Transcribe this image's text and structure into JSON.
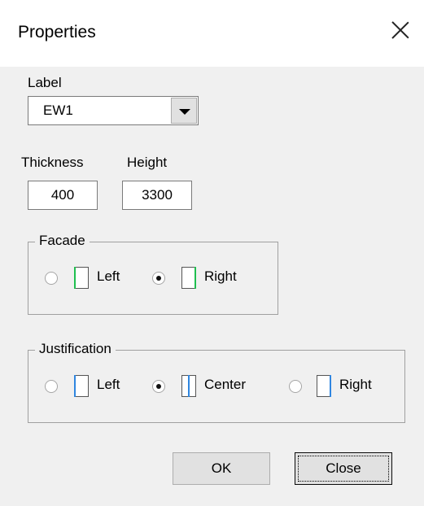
{
  "dialog": {
    "title": "Properties"
  },
  "label_field": {
    "caption": "Label",
    "value": "EW1"
  },
  "thickness_field": {
    "caption": "Thickness",
    "value": "400"
  },
  "height_field": {
    "caption": "Height",
    "value": "3300"
  },
  "facade": {
    "title": "Facade",
    "options": [
      {
        "label": "Left",
        "checked": false,
        "icon": "wall-left-face-icon"
      },
      {
        "label": "Right",
        "checked": true,
        "icon": "wall-right-face-icon"
      }
    ]
  },
  "justification": {
    "title": "Justification",
    "options": [
      {
        "label": "Left",
        "checked": false,
        "icon": "wall-left-justify-icon"
      },
      {
        "label": "Center",
        "checked": true,
        "icon": "wall-center-justify-icon"
      },
      {
        "label": "Right",
        "checked": false,
        "icon": "wall-right-justify-icon"
      }
    ]
  },
  "buttons": {
    "ok": "OK",
    "close": "Close"
  },
  "colors": {
    "facade_marker": "#1fbf4f",
    "justify_marker": "#2f86e0"
  }
}
